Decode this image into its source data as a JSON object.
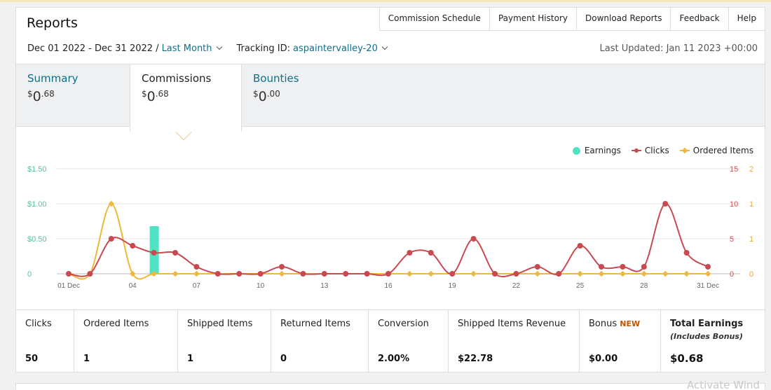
{
  "page": {
    "title": "Reports",
    "watermark": "Activate Wind"
  },
  "nav": {
    "commission_schedule": "Commission Schedule",
    "payment_history": "Payment History",
    "download_reports": "Download Reports",
    "feedback": "Feedback",
    "help": "Help"
  },
  "filters": {
    "date_range": "Dec 01 2022 - Dec 31 2022 / ",
    "period": "Last Month",
    "tracking_label": "Tracking ID: ",
    "tracking_id": "aspaintervalley-20",
    "last_updated": "Last Updated: Jan 11 2023 +00:00"
  },
  "tabs": [
    {
      "label": "Summary",
      "currency": "$",
      "whole": "0",
      "cents": ".68"
    },
    {
      "label": "Commissions",
      "currency": "$",
      "whole": "0",
      "cents": ".68"
    },
    {
      "label": "Bounties",
      "currency": "$",
      "whole": "0",
      "cents": ".00"
    }
  ],
  "legend": {
    "earnings": "Earnings",
    "clicks": "Clicks",
    "ordered": "Ordered Items"
  },
  "colors": {
    "earnings": "#50e3c2",
    "clicks": "#c9494f",
    "ordered": "#f0b83a",
    "link": "#0f6f88"
  },
  "chart_data": {
    "type": "line",
    "x": [
      1,
      2,
      3,
      4,
      5,
      6,
      7,
      8,
      9,
      10,
      11,
      12,
      13,
      14,
      15,
      16,
      17,
      18,
      19,
      20,
      21,
      22,
      23,
      24,
      25,
      26,
      27,
      28,
      29,
      30,
      31
    ],
    "x_ticks": [
      "01 Dec",
      "04",
      "07",
      "10",
      "13",
      "16",
      "19",
      "22",
      "25",
      "28",
      "31 Dec"
    ],
    "x_tick_positions": [
      1,
      4,
      7,
      10,
      13,
      16,
      19,
      22,
      25,
      28,
      31
    ],
    "y_left_ticks": [
      "$1.50",
      "$1.00",
      "$0.50",
      "0"
    ],
    "y_right_ticks_clicks": [
      "15",
      "10",
      "5",
      "0"
    ],
    "y_right_ticks_items": [
      "2",
      "1",
      "1",
      "0"
    ],
    "series": [
      {
        "name": "Earnings",
        "kind": "bar",
        "axis": "earnings",
        "values": [
          0,
          0,
          0,
          0,
          0.68,
          0,
          0,
          0,
          0,
          0,
          0,
          0,
          0,
          0,
          0,
          0,
          0,
          0,
          0,
          0,
          0,
          0,
          0,
          0,
          0,
          0,
          0,
          0,
          0,
          0,
          0
        ]
      },
      {
        "name": "Clicks",
        "kind": "line",
        "axis": "clicks",
        "values": [
          0,
          0,
          5,
          4,
          3,
          3,
          1,
          0,
          0,
          0,
          1,
          0,
          0,
          0,
          0,
          0,
          3,
          3,
          0,
          5,
          0,
          0,
          1,
          0,
          4,
          1,
          1,
          1,
          10,
          3,
          1
        ]
      },
      {
        "name": "Ordered Items",
        "kind": "line",
        "axis": "items",
        "values": [
          0,
          0,
          1,
          0,
          0,
          0,
          0,
          0,
          0,
          0,
          0,
          0,
          0,
          0,
          0,
          0,
          0,
          0,
          0,
          0,
          0,
          0,
          0,
          0,
          0,
          0,
          0,
          0,
          0,
          0,
          0
        ]
      }
    ],
    "ylim_earnings": [
      0,
      1.5
    ],
    "ylim_clicks": [
      0,
      15
    ],
    "ylim_items": [
      0,
      1.5
    ]
  },
  "stats": [
    {
      "label": "Clicks",
      "value": "50"
    },
    {
      "label": "Ordered Items",
      "value": "1"
    },
    {
      "label": "Shipped Items",
      "value": "1"
    },
    {
      "label": "Returned Items",
      "value": "0"
    },
    {
      "label": "Conversion",
      "value": "2.00%"
    },
    {
      "label": "Shipped Items Revenue",
      "value": "$22.78"
    },
    {
      "label": "Bonus",
      "badge": "NEW",
      "value": "$0.00"
    },
    {
      "label": "Total Earnings",
      "sub": "(Includes Bonus)",
      "value": "$0.68"
    }
  ]
}
